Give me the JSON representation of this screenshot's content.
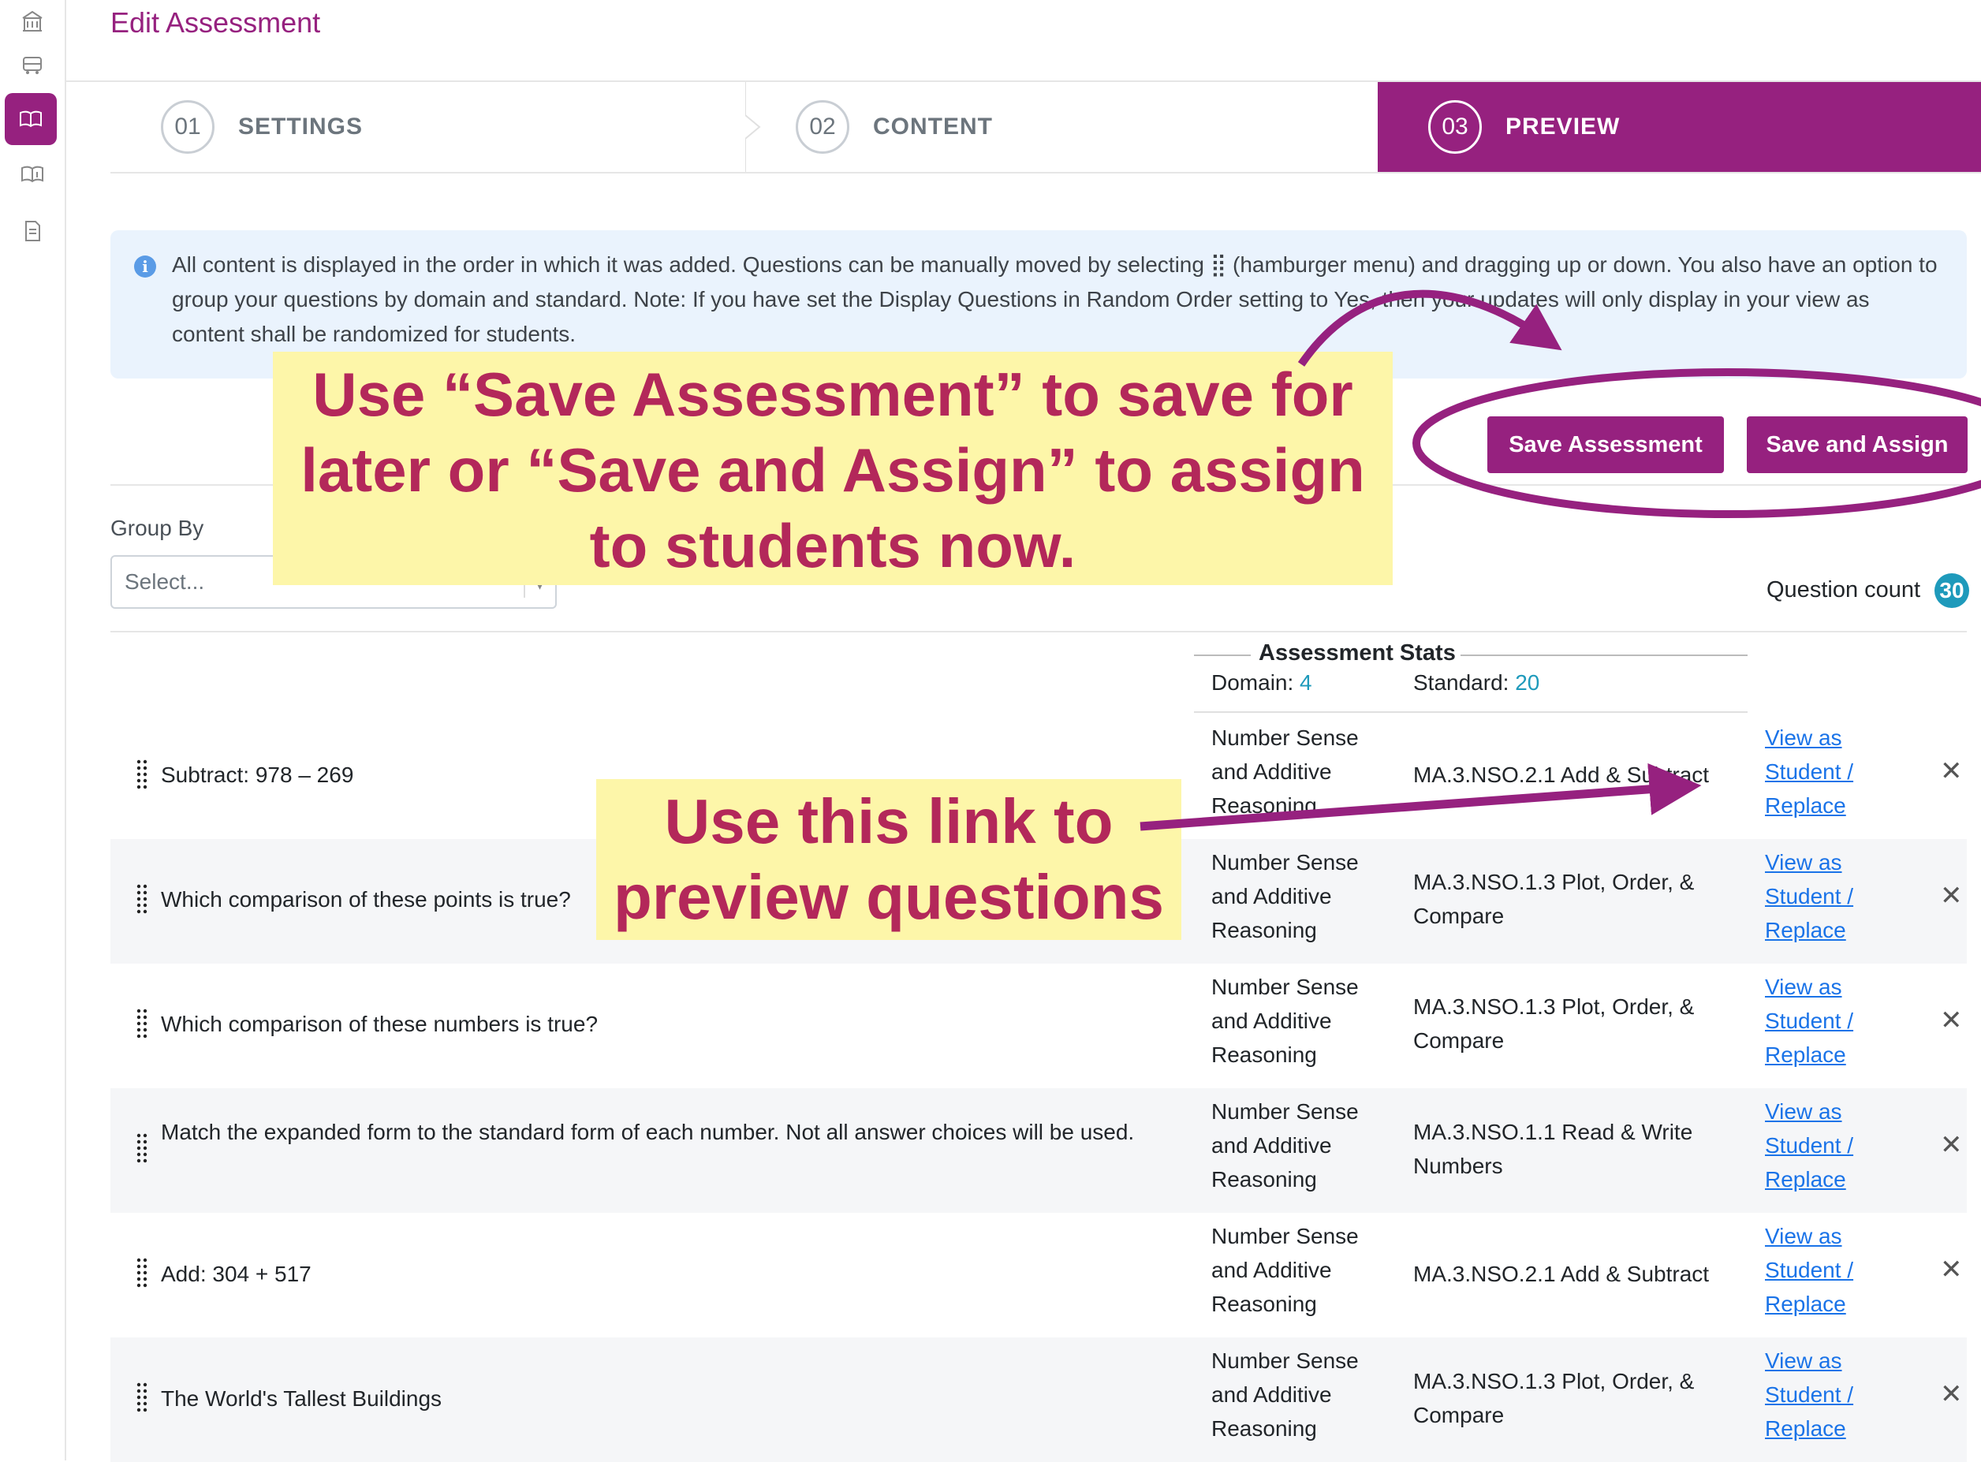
{
  "page": {
    "title": "Edit Assessment"
  },
  "sidebar": {
    "icons": [
      "building-icon",
      "bus-icon",
      "book-open-icon",
      "book-info-icon",
      "document-icon"
    ],
    "active_index": 2
  },
  "steps": [
    {
      "num": "01",
      "label": "SETTINGS"
    },
    {
      "num": "02",
      "label": "CONTENT"
    },
    {
      "num": "03",
      "label": "PREVIEW"
    }
  ],
  "info": {
    "text": "All content is displayed in the order in which it was added. Questions can be manually moved by selecting ⣿ (hamburger menu) and dragging up or down. You also have an option to group your questions by domain and standard. Note: If you have set the Display Questions in Random Order setting to Yes, then your updates will only display in your view as content shall be randomized for students."
  },
  "actions": {
    "save": "Save Assessment",
    "save_assign": "Save and Assign"
  },
  "group_by": {
    "label": "Group By",
    "placeholder": "Select..."
  },
  "question_count": {
    "label": "Question count",
    "value": "30"
  },
  "stats": {
    "title": "Assessment Stats",
    "domain_label": "Domain:",
    "domain_value": "4",
    "standard_label": "Standard:",
    "standard_value": "20"
  },
  "link_lines": [
    "View as",
    "Student /",
    "Replace"
  ],
  "rows": [
    {
      "question": "Subtract: 978 – 269",
      "domain": "Number Sense and Additive Reasoning",
      "standard": "MA.3.NSO.2.1 Add & Subtract"
    },
    {
      "question": "Which comparison of these points is true?",
      "domain": "Number Sense and Additive Reasoning",
      "standard": "MA.3.NSO.1.3 Plot, Order, & Compare"
    },
    {
      "question": "Which comparison of these numbers is true?",
      "domain": "Number Sense and Additive Reasoning",
      "standard": "MA.3.NSO.1.3 Plot, Order, & Compare"
    },
    {
      "question": "Match the expanded form to the standard form of each number. Not all answer choices will be used.",
      "domain": "Number Sense and Additive Reasoning",
      "standard": "MA.3.NSO.1.1 Read & Write Numbers"
    },
    {
      "question": "Add: 304 + 517",
      "domain": "Number Sense and Additive Reasoning",
      "standard": "MA.3.NSO.2.1 Add & Subtract"
    },
    {
      "question": "The World's Tallest Buildings",
      "domain": "Number Sense and Additive Reasoning",
      "standard": "MA.3.NSO.1.3 Plot, Order, & Compare"
    }
  ],
  "annotations": {
    "save_note": "Use “Save Assessment” to save for later or “Save and Assign” to assign to students now.",
    "link_note": "Use this link to preview questions"
  },
  "colors": {
    "brand": "#96217f",
    "annotation_text": "#b3285a",
    "annotation_bg": "#fdf6a9",
    "link": "#1a73e8",
    "badge": "#1e9abb"
  }
}
